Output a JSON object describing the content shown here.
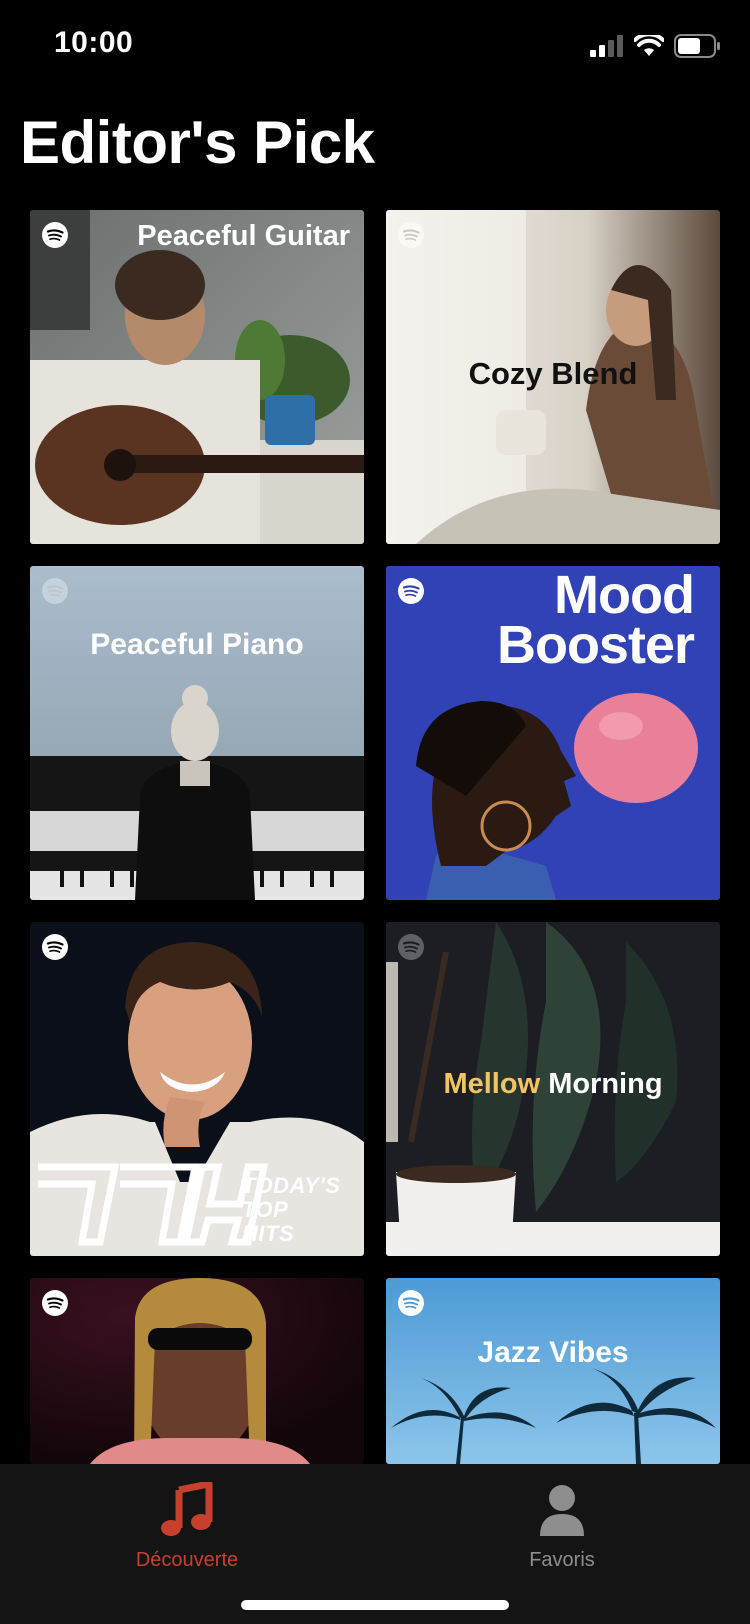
{
  "status_bar": {
    "time": "10:00"
  },
  "title": "Editor's Pick",
  "playlists": [
    {
      "title": "Peaceful Guitar"
    },
    {
      "title": "Cozy Blend"
    },
    {
      "title": "Peaceful Piano"
    },
    {
      "title_line1": "Mood",
      "title_line2": "Booster"
    },
    {
      "title_line1": "TODAY'S",
      "title_line2": "TOP",
      "title_line3": "HITS"
    },
    {
      "title_part1": "Mellow",
      "title_part2": "Morning"
    },
    {
      "title": ""
    },
    {
      "title": "Jazz Vibes"
    }
  ],
  "tabs": [
    {
      "label": "Découverte",
      "icon": "music-note-icon",
      "active": true
    },
    {
      "label": "Favoris",
      "icon": "person-icon",
      "active": false
    }
  ],
  "colors": {
    "background": "#000000",
    "tab_bar": "#141414",
    "active_tab": "#c7402d",
    "inactive_tab": "#8e8e8e",
    "mood_booster_blue": "#2f3fb4",
    "mellow_yellow": "#f4c363"
  }
}
